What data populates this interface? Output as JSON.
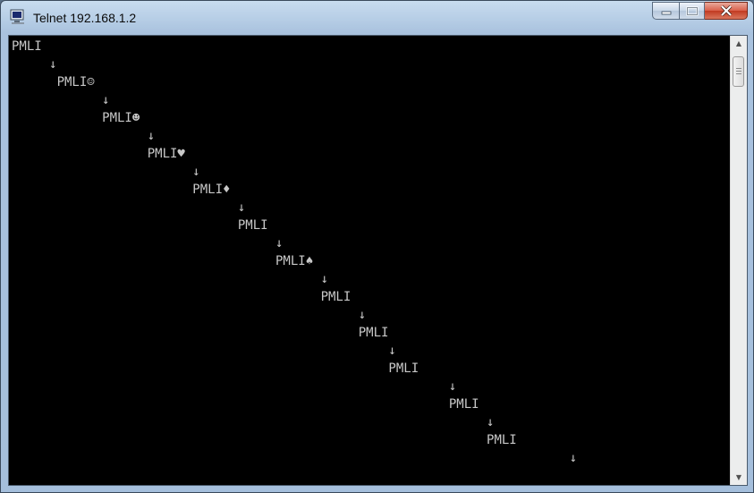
{
  "window": {
    "title": "Telnet 192.168.1.2",
    "app_icon": "telnet-terminal-icon"
  },
  "controls": {
    "minimize": "minimize-icon",
    "maximize": "maximize-icon",
    "close": "close-icon"
  },
  "terminal": {
    "lines": [
      "PMLI",
      "     ↓",
      "      PMLI☺",
      "            ↓",
      "            PMLI☻",
      "                  ↓",
      "                  PMLI♥",
      "                        ↓",
      "                        PMLI♦",
      "                              ↓",
      "                              PMLI",
      "                                   ↓",
      "                                   PMLI♠",
      "                                         ↓",
      "                                         PMLI",
      "                                              ↓",
      "                                              PMLI",
      "                                                  ↓",
      "                                                  PMLI",
      "                                                          ↓",
      "                                                          PMLI",
      "                                                               ↓",
      "                                                               PMLI",
      "                                                                          ↓"
    ]
  },
  "scrollbar": {
    "up_arrow": "▲",
    "down_arrow": "▼"
  }
}
